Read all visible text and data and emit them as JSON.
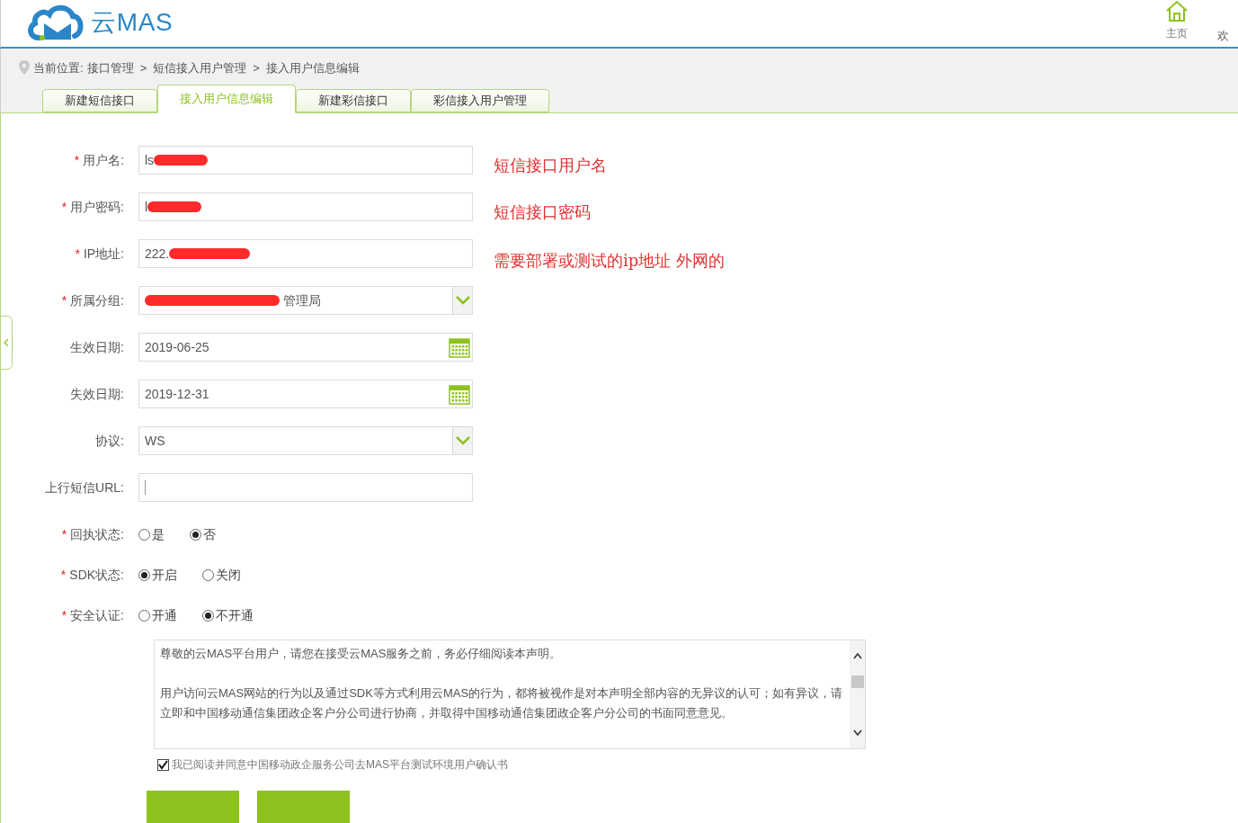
{
  "header": {
    "logo_text": "云MAS",
    "nav": [
      {
        "label": "主页",
        "kind": "home"
      },
      {
        "label": "欢",
        "kind": "text"
      }
    ]
  },
  "breadcrumb": {
    "label": "当前位置:",
    "path": [
      "接口管理",
      "短信接入用户管理",
      "接入用户信息编辑"
    ],
    "separator": ">"
  },
  "tabs": [
    {
      "label": "新建短信接口",
      "selected": false
    },
    {
      "label": "接入用户信息编辑",
      "selected": true
    },
    {
      "label": "新建彩信接口",
      "selected": false
    },
    {
      "label": "彩信接入用户管理",
      "selected": false
    }
  ],
  "form": [
    {
      "kind": "text",
      "label": "用户名:",
      "required_mark": "*",
      "value": "ls",
      "redacted": true,
      "note": "短信接口用户名"
    },
    {
      "kind": "text",
      "label": "用户密码:",
      "required_mark": "*",
      "value": "l",
      "redacted": true,
      "note": "短信接口密码"
    },
    {
      "kind": "text",
      "label": "IP地址:",
      "required_mark": "*",
      "value": "222.",
      "redacted": true,
      "note": "需要部署或测试的ip地址 外网的"
    },
    {
      "kind": "select",
      "label": "所属分组:",
      "required_mark": "*",
      "value": "管理局",
      "redacted": true
    },
    {
      "kind": "date",
      "label": "生效日期:",
      "value": "2019-06-25"
    },
    {
      "kind": "date",
      "label": "失效日期:",
      "value": "2019-12-31"
    },
    {
      "kind": "select",
      "label": "协议:",
      "value": "WS"
    },
    {
      "kind": "text",
      "label": "上行短信URL:"
    },
    {
      "kind": "radio",
      "label": "回执状态:",
      "required_mark": "*",
      "options": [
        {
          "label": "是",
          "selected": false
        },
        {
          "label": "否",
          "selected": true
        }
      ]
    },
    {
      "kind": "radio",
      "label": "SDK状态:",
      "required_mark": "*",
      "options": [
        {
          "label": "开启",
          "selected": true
        },
        {
          "label": "关闭",
          "selected": false
        }
      ]
    },
    {
      "kind": "radio",
      "label": "安全认证:",
      "required_mark": "*",
      "options": [
        {
          "label": "开通",
          "selected": false
        },
        {
          "label": "不开通",
          "selected": true
        }
      ]
    }
  ],
  "agreement": {
    "paragraphs": [
      "尊敬的云MAS平台用户，请您在接受云MAS服务之前，务必仔细阅读本声明。",
      "用户访问云MAS网站的行为以及通过SDK等方式利用云MAS的行为，都将被视作是对本声明全部内容的无异议的认可；如有异议，请立即和中国移动通信集团政企客户分公司进行协商，并取得中国移动通信集团政企客户分公司的书面同意意见。"
    ],
    "confirm": {
      "label": "我已阅读并同意中国移动政企服务公司去MAS平台测试环境用户确认书",
      "checked": true
    }
  },
  "buttons": [
    {
      "kind": "primary"
    },
    {
      "kind": "primary"
    }
  ]
}
